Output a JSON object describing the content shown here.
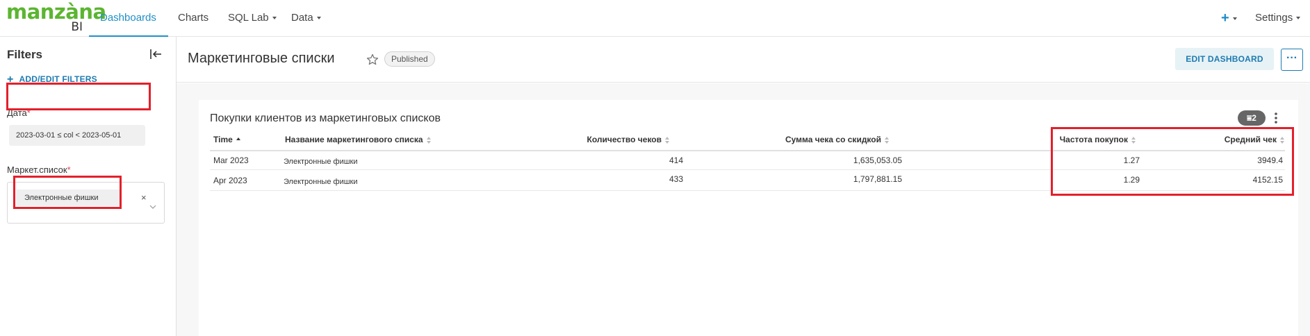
{
  "nav": {
    "logo_brand": "manzàna",
    "logo_suffix": "BI",
    "items": [
      {
        "label": "Dashboards"
      },
      {
        "label": "Charts"
      },
      {
        "label": "SQL Lab"
      },
      {
        "label": "Data"
      }
    ],
    "plus_icon": "plus-icon",
    "settings_label": "Settings"
  },
  "sidebar": {
    "title": "Filters",
    "add_filters_label": "ADD/EDIT FILTERS",
    "date_filter": {
      "label": "Дата",
      "required_mark": "*",
      "value": "2023-03-01 ≤ col < 2023-05-01"
    },
    "list_filter": {
      "label": "Маркет.список",
      "required_mark": "*",
      "selected_tag": "Электронные фишки",
      "remove_glyph": "×"
    }
  },
  "header": {
    "title": "Маркетинговые списки",
    "status_badge": "Published",
    "edit_label": "EDIT DASHBOARD",
    "more_label": "···"
  },
  "chart": {
    "title": "Покупки клиентов из маркетинговых списков",
    "filter_count": "2",
    "accent_color": "#e3202b"
  },
  "chart_data": {
    "type": "table",
    "title": "Покупки клиентов из маркетинговых списков",
    "columns": [
      "Time",
      "Название маркетингового списка",
      "Количество чеков",
      "Сумма чека со скидкой",
      "Частота покупок",
      "Средний чек"
    ],
    "rows": [
      [
        "Mar 2023",
        "Электронные фишки",
        "414",
        "1,635,053.05",
        "1.27",
        "3949.4"
      ],
      [
        "Apr 2023",
        "Электронные фишки",
        "433",
        "1,797,881.15",
        "1.29",
        "4152.15"
      ]
    ]
  }
}
